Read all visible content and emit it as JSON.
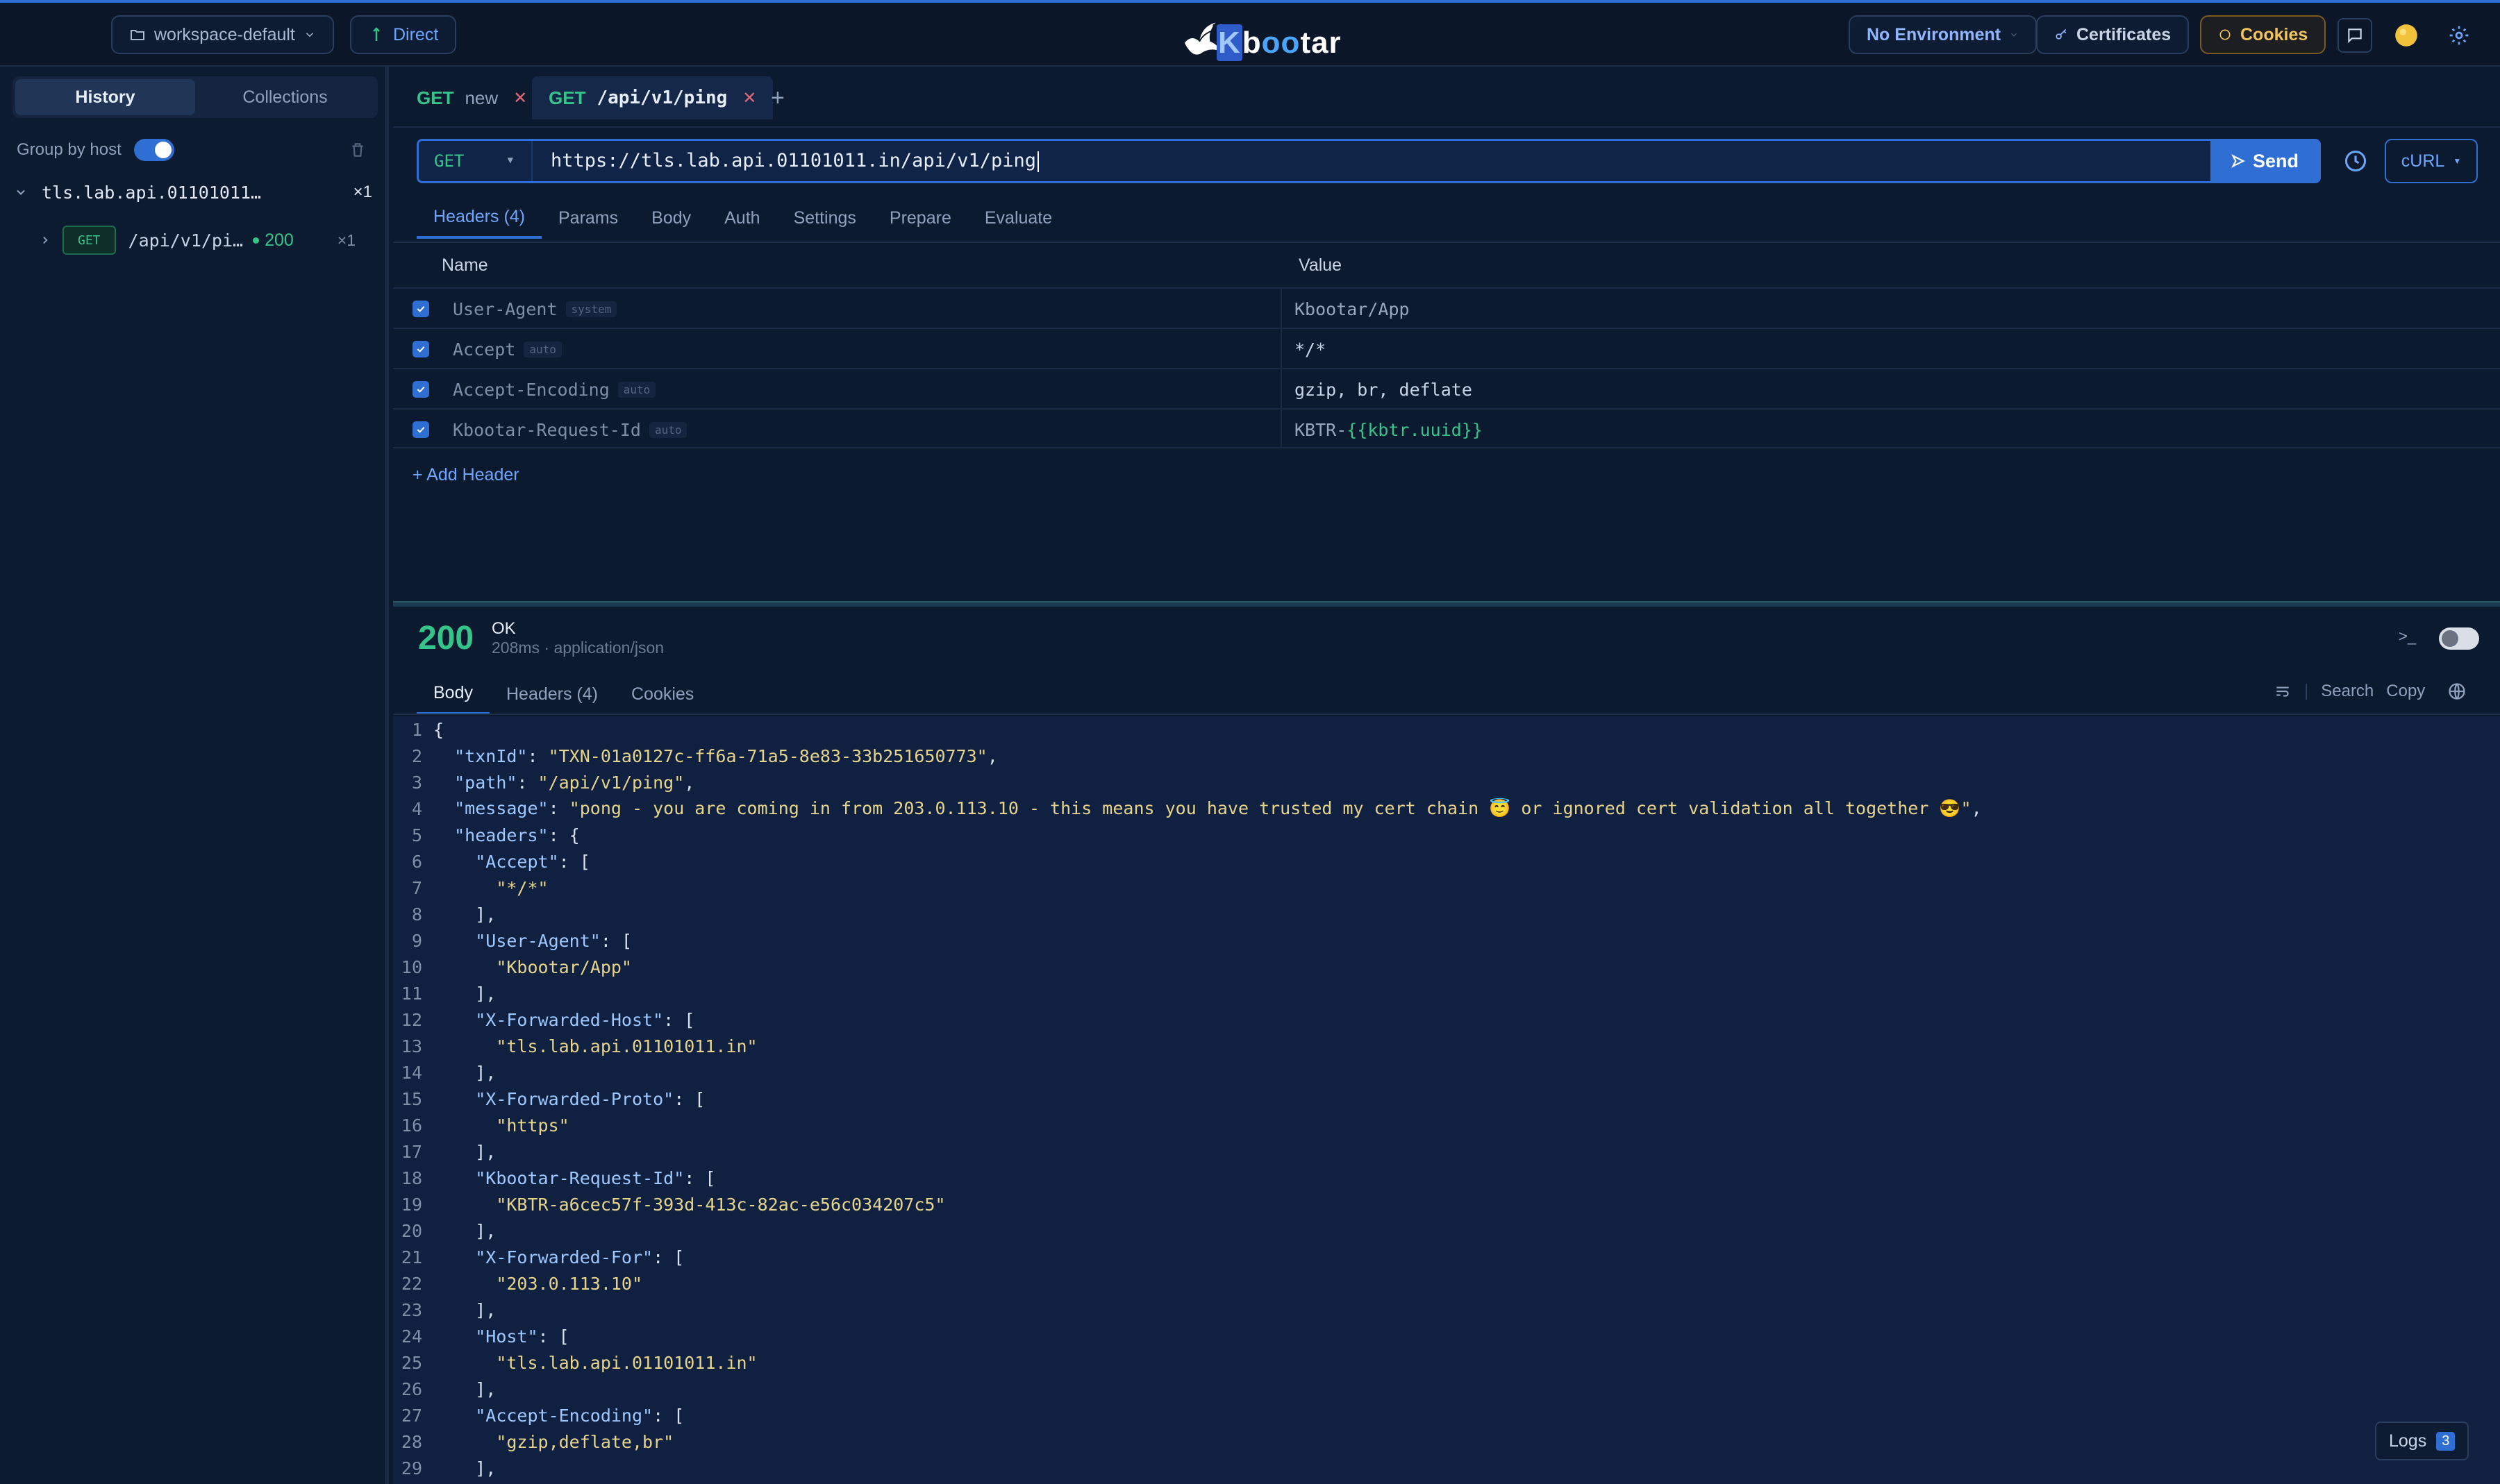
{
  "topbar": {
    "workspace": "workspace-default",
    "mode": "Direct",
    "environment": "No Environment",
    "certificates": "Certificates",
    "cookies": "Cookies",
    "logo_pre": "K",
    "logo_mid": "b",
    "logo_oo": "oo",
    "logo_post": "tar"
  },
  "sidebar": {
    "tabs": [
      "History",
      "Collections"
    ],
    "group_by_host": "Group by host",
    "host": "tls.lab.api.01101011…",
    "host_count": "×1",
    "request": {
      "method": "GET",
      "path": "/api/v1/pi…",
      "status": "200",
      "count": "×1"
    }
  },
  "tabs": [
    {
      "method": "GET",
      "label": "new"
    },
    {
      "method": "GET",
      "label": "/api/v1/ping"
    }
  ],
  "request": {
    "method": "GET",
    "url": "https://tls.lab.api.01101011.in/api/v1/ping",
    "send": "Send",
    "curl": "cURL",
    "subtabs": [
      "Headers (4)",
      "Params",
      "Body",
      "Auth",
      "Settings",
      "Prepare",
      "Evaluate"
    ],
    "col_name": "Name",
    "col_value": "Value",
    "headers": [
      {
        "name": "User-Agent",
        "tag": "system",
        "value": "Kbootar/App"
      },
      {
        "name": "Accept",
        "tag": "auto",
        "value": "*/*"
      },
      {
        "name": "Accept-Encoding",
        "tag": "auto",
        "value": "gzip, br, deflate"
      },
      {
        "name": "Kbootar-Request-Id",
        "tag": "auto",
        "value_prefix": "KBTR-",
        "value_var": "{{kbtr.uuid}}"
      }
    ],
    "add_header": "+ Add Header"
  },
  "response": {
    "status_code": "200",
    "status_text": "OK",
    "meta": "208ms · application/json",
    "tabs": [
      "Body",
      "Headers (4)",
      "Cookies"
    ],
    "search": "Search",
    "copy": "Copy",
    "logs": "Logs",
    "logs_count": "3",
    "body_lines": [
      "{",
      "  \"txnId\": \"TXN-01a0127c-ff6a-71a5-8e83-33b251650773\",",
      "  \"path\": \"/api/v1/ping\",",
      "  \"message\": \"pong - you are coming in from 203.0.113.10 - this means you have trusted my cert chain 😇 or ignored cert validation all together 😎\",",
      "  \"headers\": {",
      "    \"Accept\": [",
      "      \"*/*\"",
      "    ],",
      "    \"User-Agent\": [",
      "      \"Kbootar/App\"",
      "    ],",
      "    \"X-Forwarded-Host\": [",
      "      \"tls.lab.api.01101011.in\"",
      "    ],",
      "    \"X-Forwarded-Proto\": [",
      "      \"https\"",
      "    ],",
      "    \"Kbootar-Request-Id\": [",
      "      \"KBTR-a6cec57f-393d-413c-82ac-e56c034207c5\"",
      "    ],",
      "    \"X-Forwarded-For\": [",
      "      \"203.0.113.10\"",
      "    ],",
      "    \"Host\": [",
      "      \"tls.lab.api.01101011.in\"",
      "    ],",
      "    \"Accept-Encoding\": [",
      "      \"gzip,deflate,br\"",
      "    ],"
    ]
  },
  "colors": {
    "accent": "#2f6fd3",
    "success": "#35c48a",
    "background": "#0c1a30",
    "cookies_accent": "#d9a43b"
  }
}
